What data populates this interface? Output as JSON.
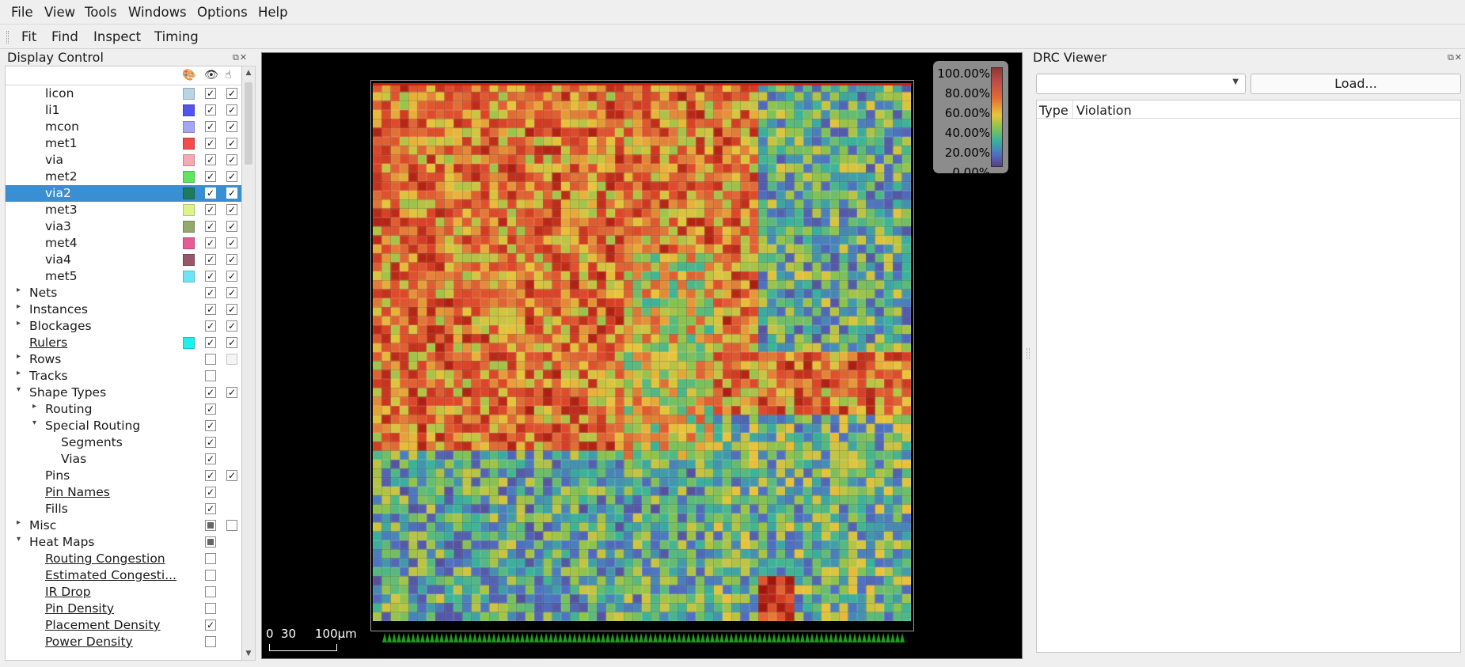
{
  "menu": [
    "File",
    "View",
    "Tools",
    "Windows",
    "Options",
    "Help"
  ],
  "toolbar": [
    "Fit",
    "Find",
    "Inspect",
    "Timing"
  ],
  "display_control": {
    "title": "Display Control",
    "header_icons": [
      "palette-icon",
      "eye-icon",
      "hand-icon"
    ],
    "rows": [
      {
        "label": "licon",
        "indent": 2,
        "color": "#b9d4e2",
        "vis": "on",
        "sel": "on"
      },
      {
        "label": "li1",
        "indent": 2,
        "color": "#5353ee",
        "vis": "on",
        "sel": "on"
      },
      {
        "label": "mcon",
        "indent": 2,
        "color": "#a5a5f5",
        "vis": "on",
        "sel": "on"
      },
      {
        "label": "met1",
        "indent": 2,
        "color": "#f54b4b",
        "vis": "on",
        "sel": "on"
      },
      {
        "label": "via",
        "indent": 2,
        "color": "#f6a8b4",
        "vis": "on",
        "sel": "on"
      },
      {
        "label": "met2",
        "indent": 2,
        "color": "#5ee55e",
        "vis": "on",
        "sel": "on"
      },
      {
        "label": "via2",
        "indent": 2,
        "color": "#1e7c5c",
        "vis": "on",
        "sel": "on",
        "selected": true
      },
      {
        "label": "met3",
        "indent": 2,
        "color": "#dcf58a",
        "vis": "on",
        "sel": "on"
      },
      {
        "label": "via3",
        "indent": 2,
        "color": "#93a86b",
        "vis": "on",
        "sel": "on"
      },
      {
        "label": "met4",
        "indent": 2,
        "color": "#e55c96",
        "vis": "on",
        "sel": "on"
      },
      {
        "label": "via4",
        "indent": 2,
        "color": "#96566c",
        "vis": "on",
        "sel": "on"
      },
      {
        "label": "met5",
        "indent": 2,
        "color": "#6ee4f6",
        "vis": "on",
        "sel": "on"
      },
      {
        "label": "Nets",
        "indent": 1,
        "arrow": "right",
        "vis": "on",
        "sel": "on"
      },
      {
        "label": "Instances",
        "indent": 1,
        "arrow": "right",
        "vis": "on",
        "sel": "on"
      },
      {
        "label": "Blockages",
        "indent": 1,
        "arrow": "right",
        "vis": "on",
        "sel": "on"
      },
      {
        "label": "Rulers",
        "indent": 1,
        "link": true,
        "color": "#1ef0f0",
        "vis": "on",
        "sel": "on"
      },
      {
        "label": "Rows",
        "indent": 1,
        "arrow": "right",
        "vis": "off",
        "sel": "dis"
      },
      {
        "label": "Tracks",
        "indent": 1,
        "arrow": "right",
        "vis": "off"
      },
      {
        "label": "Shape Types",
        "indent": 1,
        "arrow": "down",
        "vis": "on",
        "sel": "on"
      },
      {
        "label": "Routing",
        "indent": 2,
        "arrow": "right",
        "vis": "on"
      },
      {
        "label": "Special Routing",
        "indent": 2,
        "arrow": "down",
        "vis": "on"
      },
      {
        "label": "Segments",
        "indent": 3,
        "vis": "on"
      },
      {
        "label": "Vias",
        "indent": 3,
        "vis": "on"
      },
      {
        "label": "Pins",
        "indent": 2,
        "vis": "on",
        "sel": "on"
      },
      {
        "label": "Pin Names",
        "indent": 2,
        "link": true,
        "vis": "on"
      },
      {
        "label": "Fills",
        "indent": 2,
        "vis": "on"
      },
      {
        "label": "Misc",
        "indent": 1,
        "arrow": "right",
        "vis": "partial",
        "sel": "off"
      },
      {
        "label": "Heat Maps",
        "indent": 1,
        "arrow": "down",
        "vis": "partial"
      },
      {
        "label": "Routing Congestion",
        "indent": 2,
        "link": true,
        "vis": "off"
      },
      {
        "label": "Estimated Congesti...",
        "indent": 2,
        "link": true,
        "vis": "off"
      },
      {
        "label": "IR Drop",
        "indent": 2,
        "link": true,
        "vis": "off"
      },
      {
        "label": "Pin Density",
        "indent": 2,
        "link": true,
        "vis": "off"
      },
      {
        "label": "Placement Density",
        "indent": 2,
        "link": true,
        "vis": "on"
      },
      {
        "label": "Power Density",
        "indent": 2,
        "link": true,
        "vis": "off"
      }
    ]
  },
  "layout_view": {
    "heatmap_name": "Placement Density",
    "legend": [
      "100.00%",
      "80.00%",
      "60.00%",
      "40.00%",
      "20.00%",
      "0.00%"
    ],
    "scale": {
      "ticks": [
        "0",
        "30"
      ],
      "label": "100μm"
    },
    "colors": {
      "background": "#000000",
      "pins": "#1a9e1a"
    }
  },
  "drc_viewer": {
    "title": "DRC Viewer",
    "combo_value": "",
    "load_button": "Load...",
    "columns": [
      "Type",
      "Violation"
    ]
  }
}
